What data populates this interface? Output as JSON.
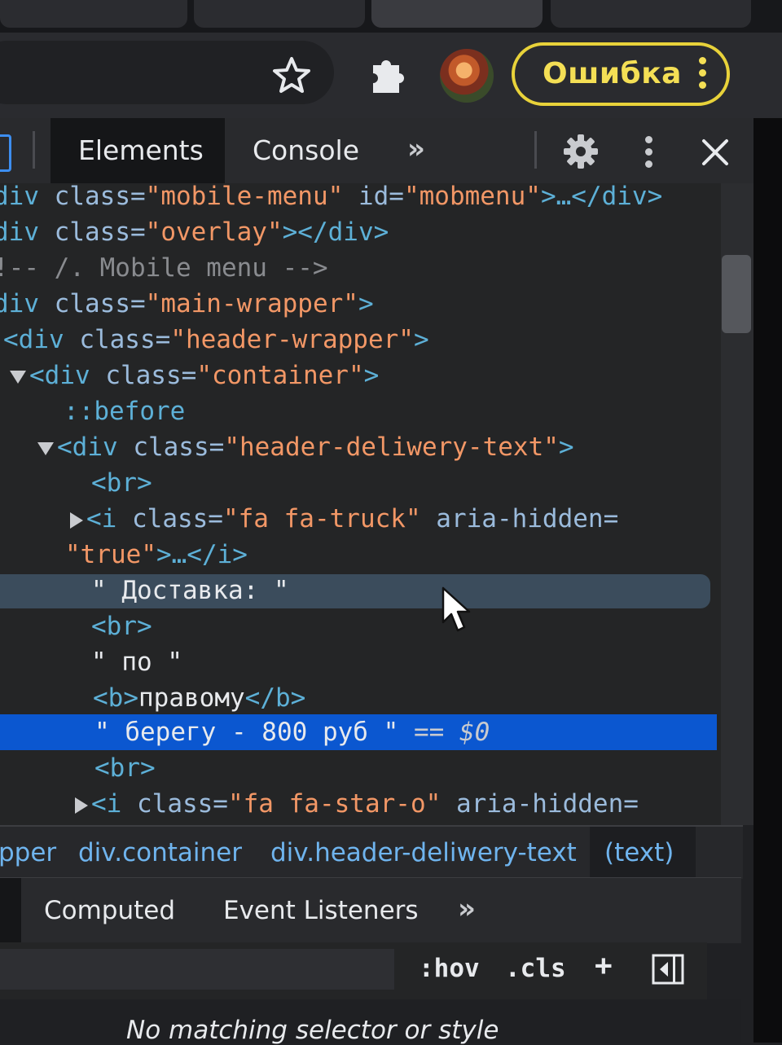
{
  "browser": {
    "error_label": "Ошибка"
  },
  "devtools": {
    "tabs": [
      "Elements",
      "Console"
    ],
    "more_tabs": "»"
  },
  "tree": {
    "l1": {
      "open": "div",
      "attr1": " class=",
      "val1": "\"mobile-menu\"",
      "attr2": " id=",
      "val2": "\"mobmenu\"",
      "rest": ">…</div>"
    },
    "l2": {
      "open": "div",
      "attr1": " class=",
      "val1": "\"overlay\"",
      "rest": "></div>"
    },
    "l3": "!-- /. Mobile menu -->",
    "l4": {
      "open": "div",
      "attr1": " class=",
      "val1": "\"main-wrapper\"",
      "rest": ">"
    },
    "l5": {
      "open": "<div",
      "attr1": " class=",
      "val1": "\"header-wrapper\"",
      "rest": ">"
    },
    "l6": {
      "open": "<div",
      "attr1": " class=",
      "val1": "\"container\"",
      "rest": ">"
    },
    "l7": "::before",
    "l8": {
      "open": "<div",
      "attr1": " class=",
      "val1": "\"header-deliwery-text\"",
      "rest": ">"
    },
    "l9": "<br>",
    "l10": {
      "open": "<i",
      "attr1": " class=",
      "val1": "\"fa fa-truck\"",
      "attr2": " aria-hidden="
    },
    "l11": {
      "val": "\"true\"",
      "rest": ">…</i>"
    },
    "l12": "\" Доставка: \"",
    "l13": "<br>",
    "l14": "\" по \"",
    "l15": {
      "open": "<b>",
      "text": "правому",
      "close": "</b>"
    },
    "l16": {
      "text": "\" берегу - 800 руб \"",
      "eq": " == ",
      "dollar": "$0"
    },
    "l17": "<br>",
    "l18": {
      "open": "<i",
      "attr1": " class=",
      "val1": "\"fa fa-star-o\"",
      "attr2": " aria-hidden="
    }
  },
  "breadcrumbs": [
    "pper",
    "div.container",
    "div.header-deliwery-text",
    "(text)"
  ],
  "styles": {
    "tabs": [
      "Computed",
      "Event Listeners"
    ],
    "more": "»",
    "hov": ":hov",
    "cls": ".cls",
    "plus": "+",
    "empty": "No matching selector or style"
  },
  "colors": {
    "tag": "#5db0d7",
    "attr_name": "#9bbbdc",
    "attr_value": "#f29766",
    "selection": "#0b57d0",
    "error_accent": "#f4df55"
  }
}
